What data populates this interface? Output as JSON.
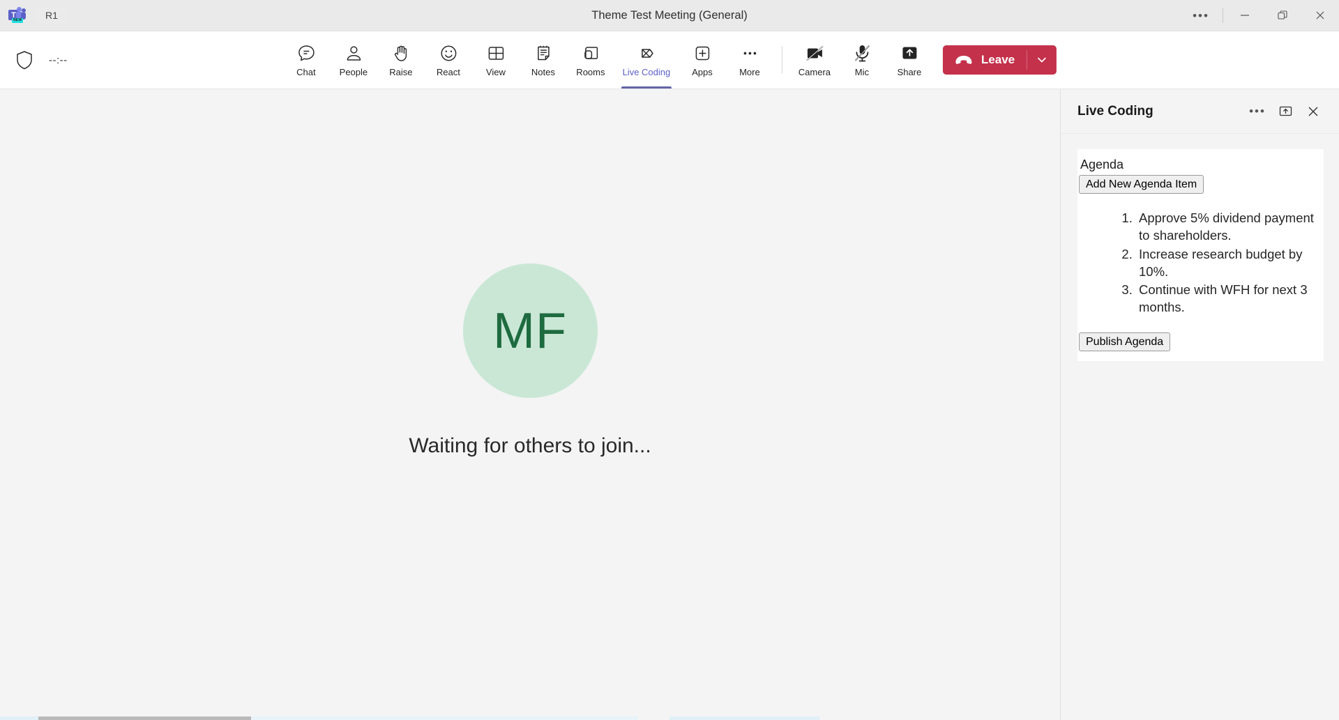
{
  "titlebar": {
    "app_tag": "R1",
    "logo_badge": "NEW",
    "logo_letter": "T",
    "meeting_title": "Theme Test Meeting (General)",
    "window_controls": [
      {
        "name": "more-options",
        "glyph": "•••"
      },
      {
        "name": "minimize",
        "glyph": "—"
      },
      {
        "name": "restore",
        "glyph": "❐"
      },
      {
        "name": "close",
        "glyph": "✕"
      }
    ]
  },
  "meetbar": {
    "timer": "--:--",
    "shield_icon": "shield-icon",
    "tools": [
      {
        "label": "Chat",
        "icon": "chat-icon",
        "active": false
      },
      {
        "label": "People",
        "icon": "people-icon",
        "active": false
      },
      {
        "label": "Raise",
        "icon": "raise-hand-icon",
        "active": false
      },
      {
        "label": "React",
        "icon": "react-icon",
        "active": false
      },
      {
        "label": "View",
        "icon": "view-grid-icon",
        "active": false
      },
      {
        "label": "Notes",
        "icon": "notes-icon",
        "active": false
      },
      {
        "label": "Rooms",
        "icon": "rooms-icon",
        "active": false
      },
      {
        "label": "Live Coding",
        "icon": "live-coding-icon",
        "active": true
      },
      {
        "label": "Apps",
        "icon": "apps-plus-icon",
        "active": false
      },
      {
        "label": "More",
        "icon": "more-dots-icon",
        "active": false
      }
    ],
    "device_controls": [
      {
        "label": "Camera",
        "icon": "camera-off-icon",
        "muted": true
      },
      {
        "label": "Mic",
        "icon": "mic-off-icon",
        "muted": true
      },
      {
        "label": "Share",
        "icon": "share-icon",
        "muted": false
      }
    ],
    "leave": {
      "label": "Leave",
      "icon": "hangup-icon",
      "caret_icon": "chevron-down-icon",
      "color": "#c4314b"
    },
    "active_indicator_color": "#6264a7"
  },
  "stage": {
    "avatar_initials": "MF",
    "avatar_bg": "#cae7d6",
    "avatar_fg": "#1e6b3f",
    "waiting_text": "Waiting for others to join..."
  },
  "panel": {
    "title": "Live Coding",
    "actions": [
      {
        "name": "panel-more-options",
        "glyph": "•••"
      },
      {
        "name": "pop-out",
        "glyph": "↑"
      },
      {
        "name": "close-panel",
        "glyph": "✕"
      }
    ],
    "agenda": {
      "label": "Agenda",
      "add_button": "Add New Agenda Item",
      "items": [
        "Approve 5% dividend payment to shareholders.",
        "Increase research budget by 10%.",
        "Continue with WFH for next 3 months."
      ],
      "publish_button": "Publish Agenda"
    }
  }
}
